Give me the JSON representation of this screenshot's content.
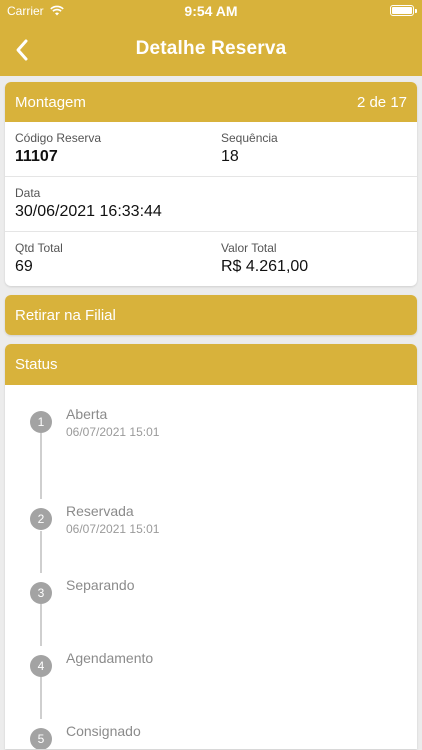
{
  "status_bar": {
    "carrier": "Carrier",
    "time": "9:54 AM"
  },
  "header": {
    "title": "Detalhe Reserva",
    "back_icon": "chevron-left-icon"
  },
  "colors": {
    "accent": "#d8b23b",
    "background": "#ececec"
  },
  "montagem": {
    "title": "Montagem",
    "page_indicator": "2 de 17",
    "codigo_label": "Código Reserva",
    "codigo_value": "11107",
    "sequencia_label": "Sequência",
    "sequencia_value": "18",
    "data_label": "Data",
    "data_value": "30/06/2021 16:33:44",
    "qtd_label": "Qtd Total",
    "qtd_value": "69",
    "valor_label": "Valor Total",
    "valor_value": "R$ 4.261,00"
  },
  "retirar": {
    "label": "Retirar na Filial"
  },
  "status": {
    "title": "Status",
    "steps": [
      {
        "number": "1",
        "name": "Aberta",
        "date": "06/07/2021 15:01"
      },
      {
        "number": "2",
        "name": "Reservada",
        "date": "06/07/2021 15:01"
      },
      {
        "number": "3",
        "name": "Separando",
        "date": ""
      },
      {
        "number": "4",
        "name": "Agendamento",
        "date": ""
      },
      {
        "number": "5",
        "name": "Consignado",
        "date": ""
      }
    ]
  }
}
